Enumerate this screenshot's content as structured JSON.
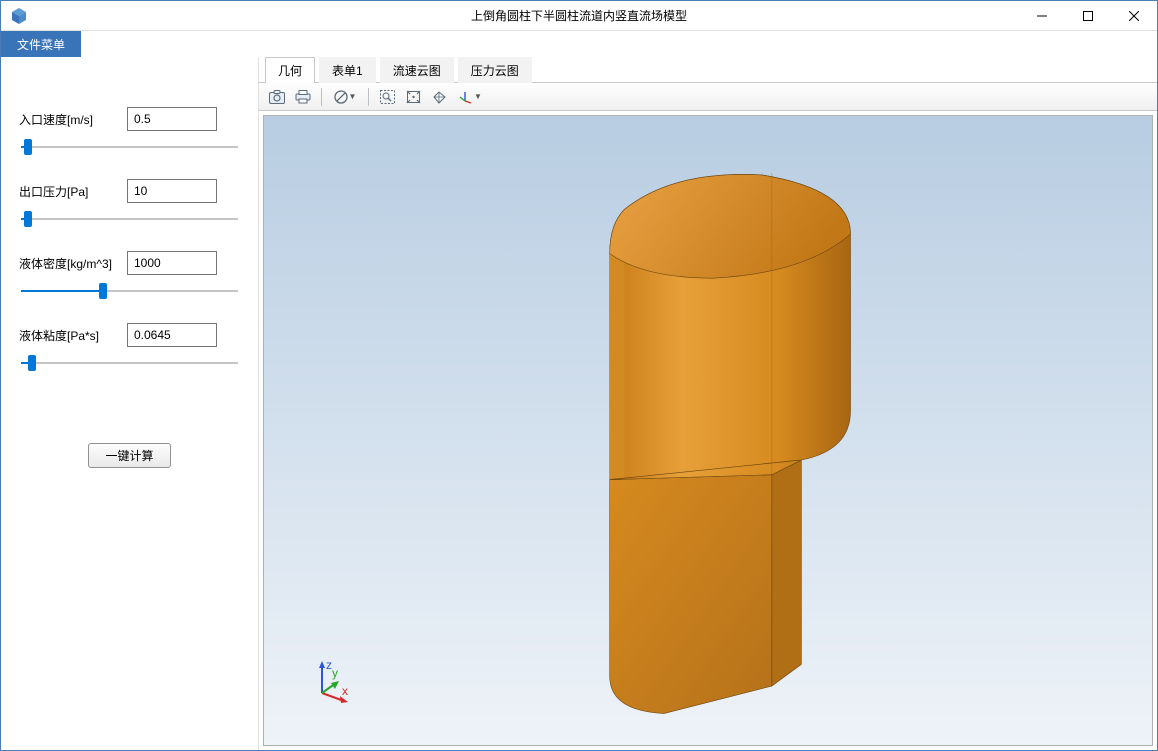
{
  "titlebar": {
    "title": "上倒角圆柱下半圆柱流道内竖直流场模型"
  },
  "menu": {
    "file": "文件菜单"
  },
  "sidebar": {
    "fields": [
      {
        "label": "入口速度[m/s]",
        "value": "0.5",
        "slider_pct": 3
      },
      {
        "label": "出口压力[Pa]",
        "value": "10",
        "slider_pct": 3
      },
      {
        "label": "液体密度[kg/m^3]",
        "value": "1000",
        "slider_pct": 38
      },
      {
        "label": "液体粘度[Pa*s]",
        "value": "0.0645",
        "slider_pct": 5
      }
    ],
    "compute_label": "一键计算"
  },
  "tabs": {
    "items": [
      "几何",
      "表单1",
      "流速云图",
      "压力云图"
    ],
    "active": 0
  },
  "axis": {
    "x": "x",
    "y": "y",
    "z": "z"
  },
  "colors": {
    "model_fill": "#d68a1f",
    "model_shadow": "#a86612",
    "model_highlight": "#e9a244",
    "accent": "#3a74b8"
  }
}
